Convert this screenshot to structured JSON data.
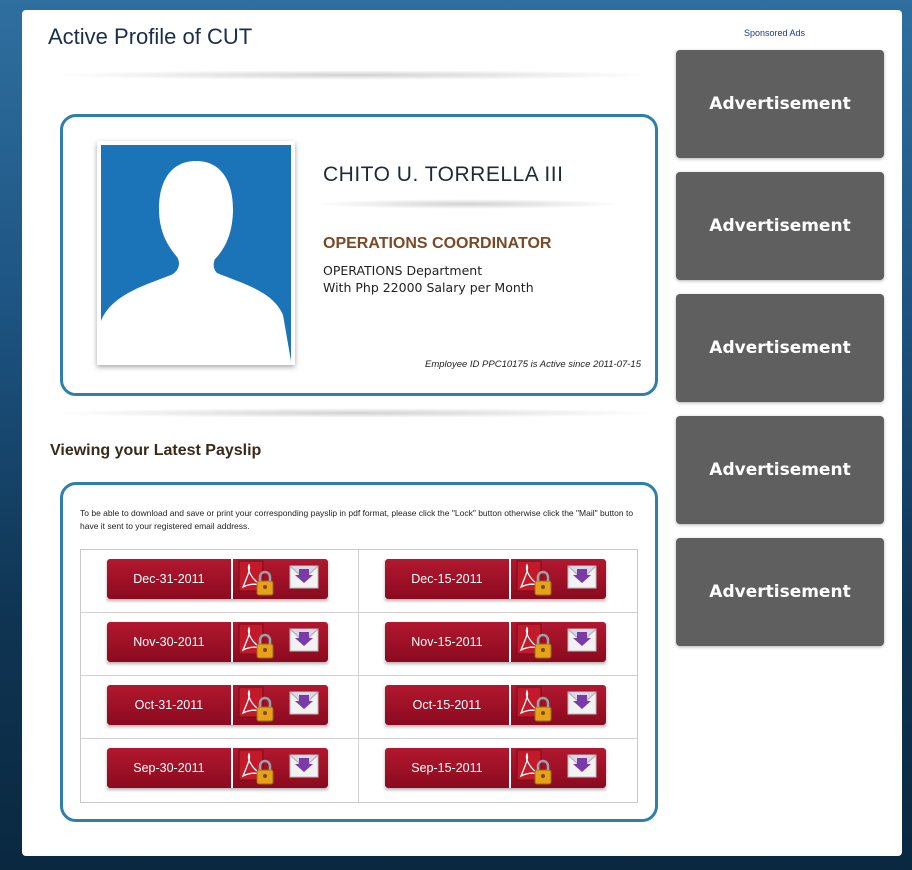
{
  "page": {
    "title": "Active Profile of CUT"
  },
  "profile": {
    "name": "CHITO U. TORRELLA III",
    "position": "OPERATIONS COORDINATOR",
    "department": "OPERATIONS Department",
    "salary": "With Php 22000 Salary per Month",
    "employee_status": "Employee ID PPC10175 is Active since 2011-07-15",
    "photo_icon": "person-silhouette-icon"
  },
  "payslip": {
    "title": "Viewing your Latest Payslip",
    "instructions": "To be able to download and save or print your corresponding payslip in pdf format, please click the \"Lock\" button otherwise click the \"Mail\" button to have it sent to your registered email address.",
    "dates": [
      "Dec-31-2011",
      "Dec-15-2011",
      "Nov-30-2011",
      "Nov-15-2011",
      "Oct-31-2011",
      "Oct-15-2011",
      "Sep-30-2011",
      "Sep-15-2011"
    ],
    "lock_icon": "pdf-lock-icon",
    "mail_icon": "mail-icon"
  },
  "ads": {
    "label": "Sponsored Ads",
    "items": [
      "Advertisement",
      "Advertisement",
      "Advertisement",
      "Advertisement",
      "Advertisement"
    ]
  },
  "colors": {
    "accent": "#2f7fa8",
    "button_red": "#a0142a",
    "position_text": "#7a4a26",
    "ad_gray": "#5f5f5f"
  }
}
